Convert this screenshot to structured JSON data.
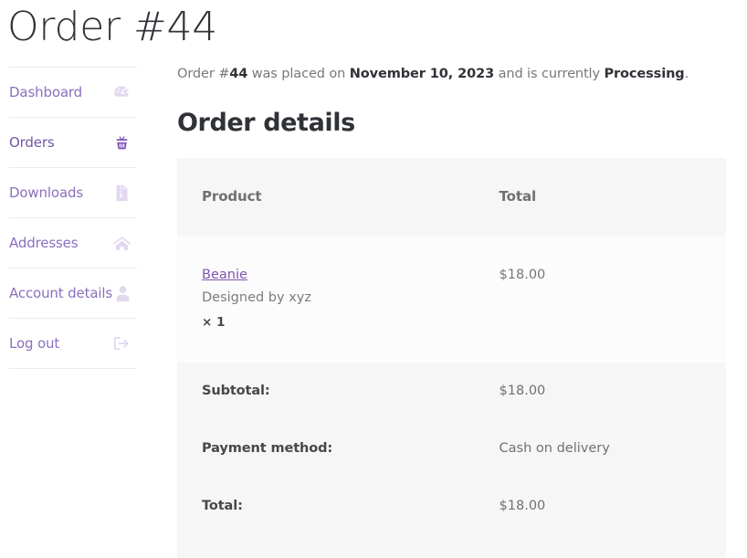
{
  "page": {
    "title": "Order #44"
  },
  "sidebar": {
    "items": [
      {
        "label": "Dashboard",
        "icon": "tachometer-icon",
        "active": false
      },
      {
        "label": "Orders",
        "icon": "basket-icon",
        "active": true
      },
      {
        "label": "Downloads",
        "icon": "file-zip-icon",
        "active": false
      },
      {
        "label": "Addresses",
        "icon": "home-icon",
        "active": false
      },
      {
        "label": "Account details",
        "icon": "user-icon",
        "active": false
      },
      {
        "label": "Log out",
        "icon": "sign-out-icon",
        "active": false
      }
    ]
  },
  "main": {
    "intro": {
      "lead": "Order #",
      "order_number": "44",
      "placed_on": " was placed on ",
      "date": "November 10, 2023",
      "currently": " and is currently ",
      "status": "Processing",
      "period": "."
    },
    "section_title": "Order details",
    "table": {
      "headers": {
        "product": "Product",
        "total": "Total"
      },
      "items": [
        {
          "name": "Beanie",
          "meta": "Designed by xyz",
          "quantity": "× 1",
          "total": "$18.00"
        }
      ],
      "footer": [
        {
          "label": "Subtotal:",
          "value": "$18.00"
        },
        {
          "label": "Payment method:",
          "value": "Cash on delivery"
        },
        {
          "label": "Total:",
          "value": "$18.00"
        }
      ]
    }
  },
  "colors": {
    "accent": "#7f54b3",
    "accent_light": "#e1d8f0",
    "link": "#8a6fbd",
    "heading": "#2f3237",
    "body_text": "#6f7173",
    "table_header_bg": "#f6f6f6",
    "table_row_bg": "#fdfcfc",
    "divider": "#ececec"
  }
}
